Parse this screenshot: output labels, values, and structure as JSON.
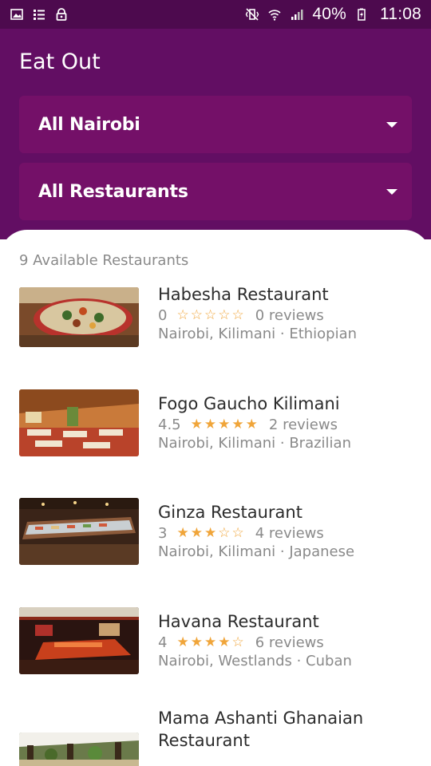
{
  "status_bar": {
    "icons_left": [
      "image-icon",
      "list-icon",
      "lock-icon"
    ],
    "icons_right": [
      "vibrate-off-icon",
      "wifi-icon",
      "signal-icon"
    ],
    "battery": "40%",
    "time": "11:08"
  },
  "header": {
    "title": "Eat Out",
    "location_filter": "All Nairobi",
    "category_filter": "All Restaurants"
  },
  "list": {
    "count_label": "9 Available Restaurants",
    "items": [
      {
        "name": "Habesha Restaurant",
        "rating": "0",
        "stars": 0,
        "reviews": "0 reviews",
        "location": "Nairobi, Kilimani · Ethiopian"
      },
      {
        "name": "Fogo Gaucho Kilimani",
        "rating": "4.5",
        "stars": 5,
        "reviews": "2 reviews",
        "location": "Nairobi, Kilimani · Brazilian"
      },
      {
        "name": "Ginza Restaurant",
        "rating": "3",
        "stars": 3,
        "reviews": "4 reviews",
        "location": "Nairobi, Kilimani · Japanese"
      },
      {
        "name": "Havana Restaurant",
        "rating": "4",
        "stars": 4,
        "reviews": "6 reviews",
        "location": "Nairobi, Westlands · Cuban"
      },
      {
        "name": "Mama Ashanti Ghanaian Restaurant"
      }
    ]
  },
  "colors": {
    "status_bar": "#4d0a4e",
    "header": "#620e63",
    "dropdown": "#741068",
    "star": "#f0a53a",
    "muted_text": "#8a8a8a"
  }
}
